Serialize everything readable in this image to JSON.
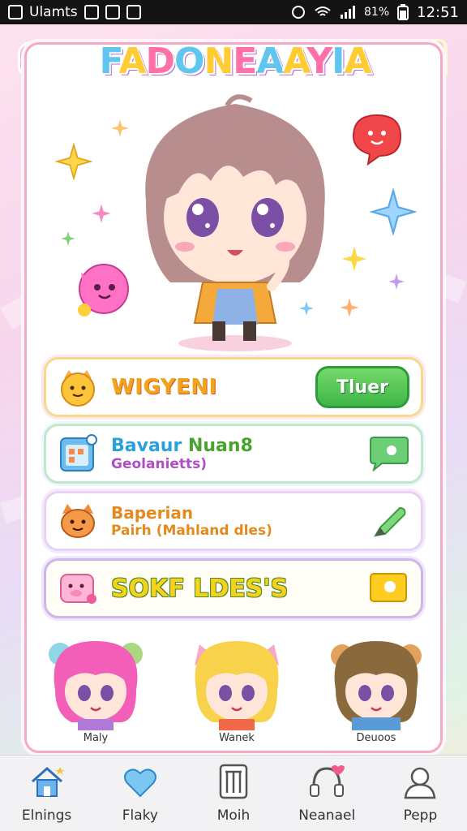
{
  "status_bar": {
    "app_label": "Ulamts",
    "clock": "12:51",
    "battery": "81%"
  },
  "header": {
    "title": "FADONEAAYIA"
  },
  "menu": {
    "row1": {
      "label": "WIGYENI",
      "button": "Tluer"
    },
    "row2": {
      "line1_a": "Bavaur",
      "line1_b": "Nuan8",
      "line2": "Geolanietts)"
    },
    "row3": {
      "line1": "Baperian",
      "line2": "Pairh (Mahland dles)"
    },
    "row4": {
      "label": "SOKF LDES'S"
    }
  },
  "characters": [
    {
      "name": "Maly",
      "hair": "#f35fb8"
    },
    {
      "name": "Wanek",
      "hair": "#f8d24a"
    },
    {
      "name": "Deuoos",
      "hair": "#8a6a3c"
    }
  ],
  "bottom_nav": [
    {
      "label": "Elnings",
      "icon": "home-icon"
    },
    {
      "label": "Flaky",
      "icon": "heart-icon"
    },
    {
      "label": "Moih",
      "icon": "book-icon"
    },
    {
      "label": "Neanael",
      "icon": "headphones-icon"
    },
    {
      "label": "Pepp",
      "icon": "profile-icon"
    }
  ],
  "colors": {
    "accent_pink": "#f4a9c7",
    "play_green": "#3fb648"
  }
}
